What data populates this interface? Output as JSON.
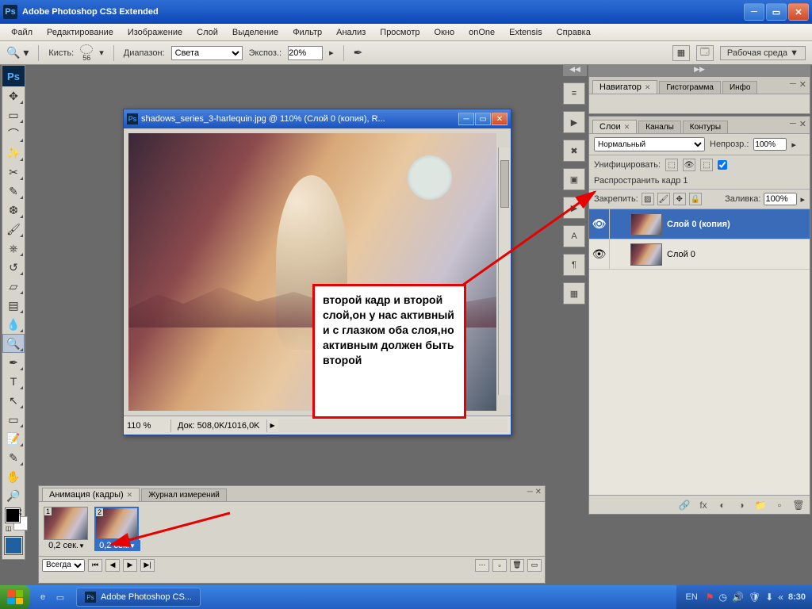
{
  "app": {
    "title": "Adobe Photoshop CS3 Extended"
  },
  "menu": [
    "Файл",
    "Редактирование",
    "Изображение",
    "Слой",
    "Выделение",
    "Фильтр",
    "Анализ",
    "Просмотр",
    "Окно",
    "onOne",
    "Extensis",
    "Справка"
  ],
  "options": {
    "brush_label": "Кисть:",
    "brush_size": "56",
    "range_label": "Диапазон:",
    "range_value": "Света",
    "exposure_label": "Экспоз.:",
    "exposure_value": "20%",
    "workspace_label": "Рабочая среда ▼"
  },
  "document": {
    "title": "shadows_series_3-harlequin.jpg @ 110% (Слой 0 (копия), R...",
    "zoom": "110 %",
    "docinfo": "Док: 508,0K/1016,0K"
  },
  "annotation": "второй кадр и второй слой,он у нас активный и с глазком оба слоя,но активным должен быть второй",
  "animation": {
    "tab1": "Анимация (кадры)",
    "tab2": "Журнал измерений",
    "frames": [
      {
        "num": "1",
        "dur": "0,2 сек."
      },
      {
        "num": "2",
        "dur": "0,2 сек."
      }
    ],
    "loop": "Всегда"
  },
  "navigator": {
    "tab1": "Навигатор",
    "tab2": "Гистограмма",
    "tab3": "Инфо"
  },
  "layers": {
    "tab1": "Слои",
    "tab2": "Каналы",
    "tab3": "Контуры",
    "blend_mode": "Нормальный",
    "opacity_label": "Непрозр.:",
    "opacity_value": "100%",
    "unify_label": "Унифицировать:",
    "propagate_label": "Распространить кадр 1",
    "lock_label": "Закрепить:",
    "fill_label": "Заливка:",
    "fill_value": "100%",
    "items": [
      {
        "name": "Слой 0 (копия)",
        "visible": true,
        "active": true
      },
      {
        "name": "Слой 0",
        "visible": true,
        "active": false
      }
    ]
  },
  "taskbar": {
    "task": "Adobe Photoshop CS...",
    "lang": "EN",
    "clock": "8:30"
  }
}
